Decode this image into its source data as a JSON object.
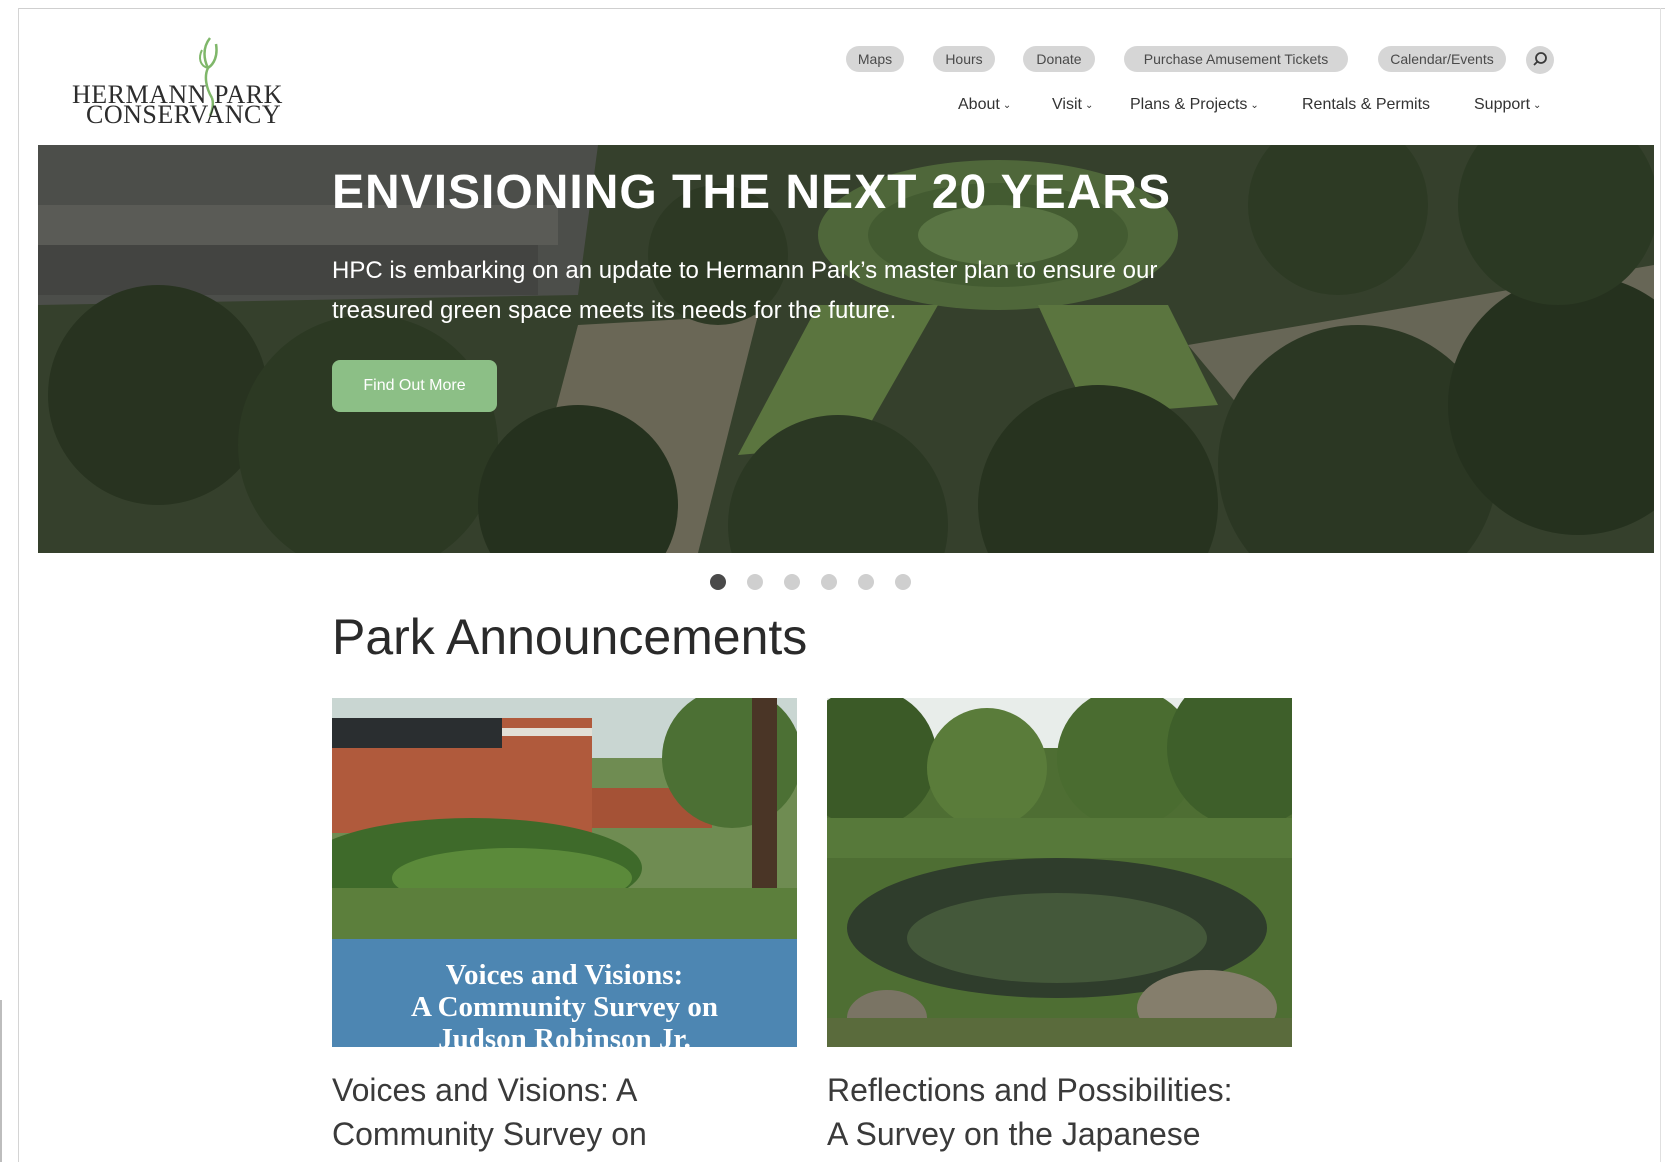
{
  "logo": {
    "line1": "HERMANN PARK",
    "line2": "CONSERVANCY"
  },
  "utility_nav": [
    {
      "label": "Maps"
    },
    {
      "label": "Hours"
    },
    {
      "label": "Donate"
    },
    {
      "label": "Purchase Amusement Tickets"
    },
    {
      "label": "Calendar/Events"
    }
  ],
  "search": {
    "icon": "search-icon"
  },
  "main_nav": [
    {
      "label": "About",
      "dropdown": true
    },
    {
      "label": "Visit",
      "dropdown": true
    },
    {
      "label": "Plans & Projects",
      "dropdown": true
    },
    {
      "label": "Rentals & Permits",
      "dropdown": false
    },
    {
      "label": "Support",
      "dropdown": true
    }
  ],
  "hero": {
    "title": "ENVISIONING THE NEXT 20 YEARS",
    "text": "HPC is embarking on an update to Hermann Park’s master plan to ensure our treasured green space meets its needs for the future.",
    "button": "Find Out More"
  },
  "carousel": {
    "slides": 6,
    "active": 1
  },
  "announcements": {
    "title": "Park Announcements",
    "cards": [
      {
        "image_banner": "Voices and Visions: A Community Survey on Judson Robinson Jr.",
        "image_banner_lines": [
          "Voices and Visions:",
          "A Community Survey on",
          "Judson Robinson Jr."
        ],
        "title_lines": [
          "Voices and Visions: A",
          "Community Survey on"
        ]
      },
      {
        "title_lines": [
          "Reflections and Possibilities:",
          "A Survey on the Japanese"
        ]
      }
    ]
  },
  "colors": {
    "pill_bg": "#d6d6d6",
    "button_green": "#8cbf86",
    "banner_blue": "#4d86b2",
    "dot_active": "#4a4a4a",
    "dot_inactive": "#cfcfcf"
  }
}
